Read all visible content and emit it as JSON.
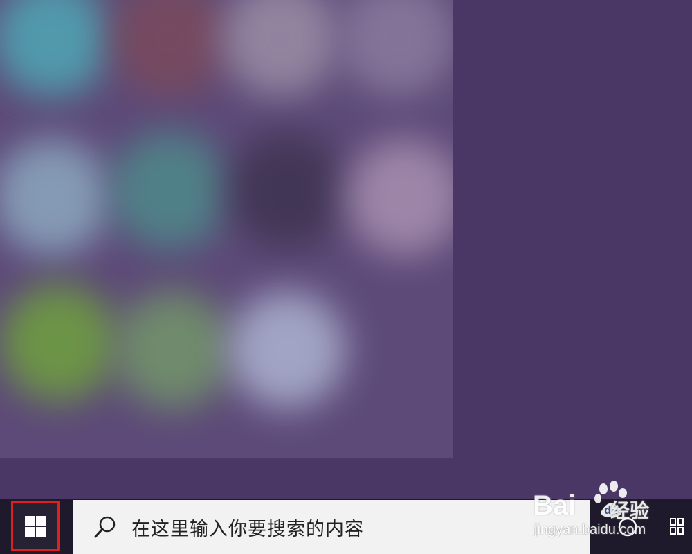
{
  "taskbar": {
    "start_button": {
      "icon": "windows-logo-icon",
      "highlight_color": "#e02020"
    },
    "search": {
      "placeholder": "在这里输入你要搜索的内容",
      "icon": "search-icon"
    },
    "cortana": {
      "icon": "circle-icon"
    },
    "task_view": {
      "icon": "task-view-icon"
    }
  },
  "start_menu": {
    "tile_colors": [
      "#4fa7b5",
      "#7a4a5c",
      "#9b8ea6",
      "#8b7b9e",
      "#8ca8c0",
      "#4e8a8a",
      "#3e3350",
      "#a890b0",
      "#6fa13e",
      "#73966a",
      "#aeb4d2",
      "#5d4a78"
    ]
  },
  "watermark": {
    "brand": "Bai",
    "brand_suffix": "经验",
    "url": "jingyan.baidu.com"
  },
  "colors": {
    "desktop": "#4b3766",
    "taskbar": "#1f1a2b",
    "search_bg": "#f2f2f2"
  }
}
